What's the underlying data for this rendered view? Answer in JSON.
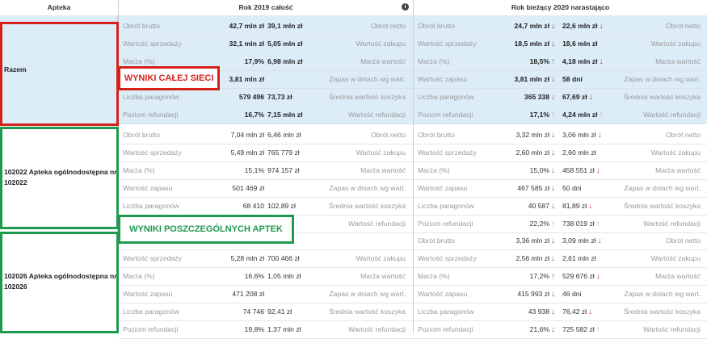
{
  "header": {
    "apteka": "Apteka",
    "col2019": "Rok 2019 całość",
    "colCurrent": "Rok bieżący 2020 narastająco",
    "info_icon": "info-icon"
  },
  "callouts": {
    "network": "WYNIKI CAŁEJ SIECI",
    "pharmacies": "WYNIKI POSZCZEGÓLNYCH APTEK"
  },
  "groups": [
    {
      "name": "Razem",
      "style": "blue",
      "rows": [
        {
          "l1": "Obrót brutto",
          "v1": "42,7 mln zł",
          "w1": "39,1 mln zł",
          "r1": "Obrót netto",
          "l2": "Obrót brutto",
          "v2": "24,7 mln zł",
          "a2": "down",
          "w2": "22,6 mln zł",
          "b2": "down",
          "r2": "Obrót netto"
        },
        {
          "l1": "Wartość sprzedaży",
          "v1": "32,1 mln zł",
          "w1": "5,05 mln zł",
          "r1": "Wartość zakupu",
          "l2": "Wartość sprzedaży",
          "v2": "18,5 mln zł",
          "a2": "down",
          "w2": "18,6 mln zł",
          "b2": "",
          "r2": "Wartość zakupu"
        },
        {
          "l1": "Marża (%)",
          "v1": "17,9%",
          "w1": "6,98 mln zł",
          "r1": "Marża wartość",
          "l2": "Marża (%)",
          "v2": "18,5%",
          "a2": "up",
          "w2": "4,18 mln zł",
          "b2": "down",
          "r2": "Marża wartość"
        },
        {
          "l1": "Wartość zapasu",
          "v1": "3,81 mln zł",
          "w1": "",
          "r1": "Zapas w dniach wg wart.",
          "l2": "Wartość zapasu",
          "v2": "3,81 mln zł",
          "a2": "down",
          "w2": "58 dni",
          "b2": "",
          "r2": "Zapas w dniach wg wart."
        },
        {
          "l1": "Liczba paragonów",
          "v1": "579 496",
          "w1": "73,73 zł",
          "r1": "Średnia wartość koszyka",
          "l2": "Liczba paragonów",
          "v2": "365 338",
          "a2": "down",
          "w2": "67,69 zł",
          "b2": "down",
          "r2": "Średnia wartość koszyka"
        },
        {
          "l1": "Poziom refundacji",
          "v1": "16,7%",
          "w1": "7,15 mln zł",
          "r1": "Wartość refundacji",
          "l2": "Poziom refundacji",
          "v2": "17,1%",
          "a2": "grey",
          "w2": "4,24 mln zł",
          "b2": "grey",
          "r2": "Wartość refundacji"
        }
      ]
    },
    {
      "name": "102022 Apteka ogólnodostępna nr 102022",
      "style": "white",
      "rows": [
        {
          "l1": "Obrót brutto",
          "v1": "7,04 mln zł",
          "w1": "6,46 mln zł",
          "r1": "Obrót netto",
          "l2": "Obrót brutto",
          "v2": "3,32 mln zł",
          "a2": "down",
          "w2": "3,06 mln zł",
          "b2": "down",
          "r2": "Obrót netto"
        },
        {
          "l1": "Wartość sprzedaży",
          "v1": "5,49 mln zł",
          "w1": "765 779 zł",
          "r1": "Wartość zakupu",
          "l2": "Wartość sprzedaży",
          "v2": "2,60 mln zł",
          "a2": "down",
          "w2": "2,60 mln zł",
          "b2": "",
          "r2": "Wartość zakupu"
        },
        {
          "l1": "Marża (%)",
          "v1": "15,1%",
          "w1": "974 157 zł",
          "r1": "Marża wartość",
          "l2": "Marża (%)",
          "v2": "15,0%",
          "a2": "down",
          "w2": "458 551 zł",
          "b2": "down",
          "r2": "Marża wartość"
        },
        {
          "l1": "Wartość zapasu",
          "v1": "501 469 zł",
          "w1": "",
          "r1": "Zapas w dniach wg wart.",
          "l2": "Wartość zapasu",
          "v2": "467 585 zł",
          "a2": "down",
          "w2": "50 dni",
          "b2": "",
          "r2": "Zapas w dniach wg wart."
        },
        {
          "l1": "Liczba paragonów",
          "v1": "68 410",
          "w1": "102,89 zł",
          "r1": "Średnia wartość koszyka",
          "l2": "Liczba paragonów",
          "v2": "40 587",
          "a2": "down",
          "w2": "81,89 zł",
          "b2": "down",
          "r2": "Średnia wartość koszyka"
        },
        {
          "l1": "",
          "v1": "",
          "w1": "zł",
          "r1": "Wartość refundacji",
          "l2": "Poziom refundacji",
          "v2": "22,2%",
          "a2": "grey",
          "w2": "738 019 zł",
          "b2": "grey",
          "r2": "Wartość refundacji"
        }
      ]
    },
    {
      "name": "102026 Apteka ogólnodostępna nr 102026",
      "style": "white",
      "rows": [
        {
          "l1": "",
          "v1": "",
          "w1": "",
          "r1": "",
          "l2": "Obrót brutto",
          "v2": "3,36 mln zł",
          "a2": "down",
          "w2": "3,09 mln zł",
          "b2": "down",
          "r2": "Obrót netto"
        },
        {
          "l1": "Wartość sprzedaży",
          "v1": "5,28 mln zł",
          "w1": "700 466 zł",
          "r1": "Wartość zakupu",
          "l2": "Wartość sprzedaży",
          "v2": "2,56 mln zł",
          "a2": "down",
          "w2": "2,61 mln zł",
          "b2": "",
          "r2": "Wartość zakupu"
        },
        {
          "l1": "Marża (%)",
          "v1": "16,6%",
          "w1": "1,05 mln zł",
          "r1": "Marża wartość",
          "l2": "Marża (%)",
          "v2": "17,2%",
          "a2": "up",
          "w2": "529 676 zł",
          "b2": "down",
          "r2": "Marża wartość"
        },
        {
          "l1": "Wartość zapasu",
          "v1": "471 208 zł",
          "w1": "",
          "r1": "Zapas w dniach wg wart.",
          "l2": "Wartość zapasu",
          "v2": "415 993 zł",
          "a2": "down",
          "w2": "46 dni",
          "b2": "",
          "r2": "Zapas w dniach wg wart."
        },
        {
          "l1": "Liczba paragonów",
          "v1": "74 746",
          "w1": "92,41 zł",
          "r1": "Średnia wartość koszyka",
          "l2": "Liczba paragonów",
          "v2": "43 938",
          "a2": "down",
          "w2": "76,42 zł",
          "b2": "down",
          "r2": "Średnia wartość koszyka"
        },
        {
          "l1": "Poziom refundacji",
          "v1": "19,8%",
          "w1": "1,37 mln zł",
          "r1": "Wartość refundacji",
          "l2": "Poziom refundacji",
          "v2": "21,6%",
          "a2": "down",
          "w2": "725 582 zł",
          "b2": "grey",
          "r2": "Wartość refundacji"
        }
      ]
    }
  ]
}
